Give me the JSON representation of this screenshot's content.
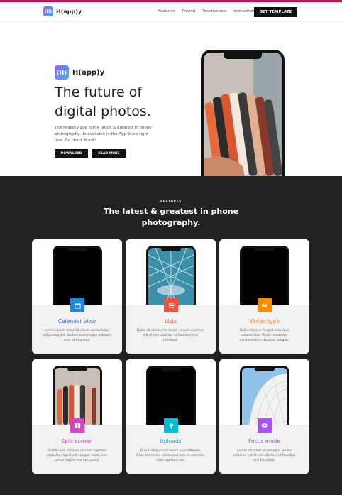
{
  "nav": {
    "logo_icon": "(H)",
    "logo_text": "H(app)y",
    "links": [
      "Features",
      "Pricing",
      "Testimonials",
      "Instructions"
    ],
    "cta": "GET TEMPLATE"
  },
  "hero": {
    "logo_icon": "(H)",
    "logo_text": "H(app)y",
    "title": "The future of digital photos.",
    "description": "The H(app)y app is the latest & greatest in phone photography. Its available in the App Store right now. Go check it out!",
    "download": "DOWNLOAD",
    "read_more": "READ MORE"
  },
  "features": {
    "kicker": "FEATURES",
    "title": "The latest & greatest in phone photography.",
    "cards": [
      {
        "title": "Calendar view",
        "text": "Lorem ipsum dolor sit amet, consectetur adipiscing elit. Nullam scelerisque aliquam odio et faucibus.",
        "icon": "calendar-icon",
        "color": "#1e88e5",
        "title_color": "#3f6fd8"
      },
      {
        "title": "Lists",
        "text": "Dolor sit amet uma turpis, iaculis euismod elit et nisi ultrices, ut faucibus orci tincidunt.",
        "icon": "list-icon",
        "color": "#f4523b",
        "title_color": "#e5533d"
      },
      {
        "title": "Varied type",
        "text": "Nulla rhoncus feugiat eros quis consectetur. Morbi neque ex, condimentum dapibus congue.",
        "icon": "type-icon",
        "color": "#fb8c00",
        "title_color": "#f0843a"
      },
      {
        "title": "Split-screen",
        "text": "Vestibulum ultrices, orci nec egestas pharetra, ligula est semper enim, nec cursor sapien leo nec purus.",
        "icon": "split-screen-icon",
        "color": "#e040c8",
        "title_color": "#d84bc9"
      },
      {
        "title": "Uploads",
        "text": "Duis tristique sed lorem a vestibulum. Cras commodo consequat orci, in convallis risus egestas non.",
        "icon": "upload-icon",
        "color": "#00bcd4",
        "title_color": "#28a9c9"
      },
      {
        "title": "Focus mode",
        "text": "Lorem sit amet urna turpis, iaculis euismod elit et nisi ultrices, ut faucibus orci tincidunt.",
        "icon": "eye-icon",
        "color": "#a855f7",
        "title_color": "#9b59e6"
      }
    ]
  }
}
